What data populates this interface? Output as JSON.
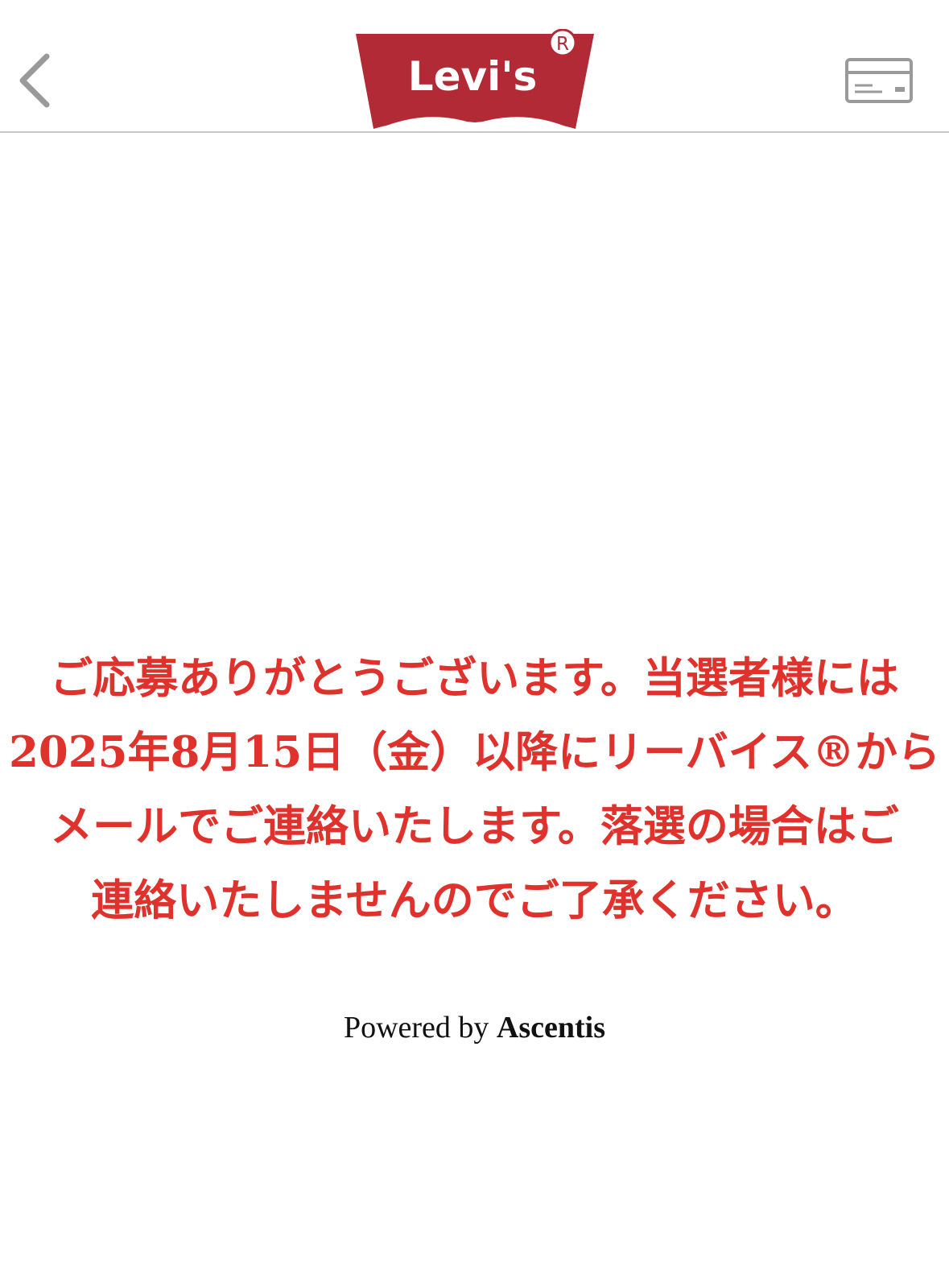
{
  "header": {
    "back_icon": "chevron-left-icon",
    "logo_text": "Levi's",
    "logo_registered": "R",
    "card_icon": "membership-card-icon"
  },
  "colors": {
    "brand_red": "#b22a35",
    "message_red": "#e0322c",
    "icon_gray": "#9a9a9a",
    "divider": "#c8c8c8"
  },
  "message": {
    "lines": [
      "ご応募ありがとうございます。当選者様には",
      "2025年8月15日（金）以降にリーバイス®から",
      "メールでご連絡いたします。落選の場合はご",
      "連絡いたしませんのでご了承ください。"
    ]
  },
  "footer": {
    "powered_prefix": "Powered by",
    "powered_brand": "Ascentis"
  }
}
